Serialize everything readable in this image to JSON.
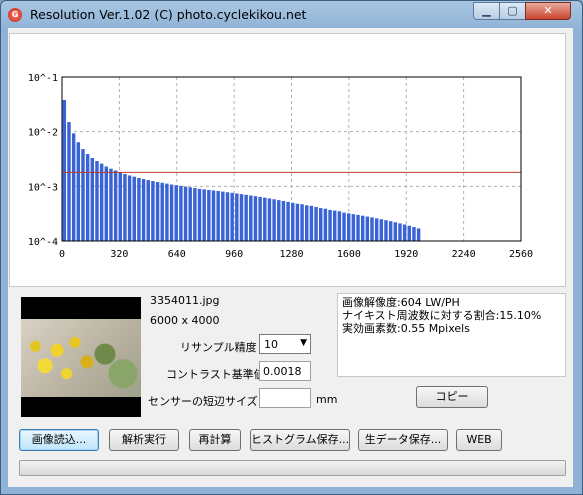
{
  "window": {
    "title": "Resolution Ver.1.02 (C) photo.cyclekikou.net",
    "app_icon": "red-circle-app-icon",
    "controls": {
      "minimize": "minimize-icon",
      "maximize": "maximize-icon",
      "close": "close-icon"
    }
  },
  "chart_data": {
    "type": "bar",
    "yscale": "log",
    "ylim": [
      "10^-4",
      "10^-1"
    ],
    "y_ticks": [
      "10^-1",
      "10^-2",
      "10^-3",
      "10^-4"
    ],
    "x_ticks": [
      "0",
      "320",
      "640",
      "960",
      "1280",
      "1600",
      "1920",
      "2240",
      "2560"
    ],
    "xlim": [
      0,
      2560
    ],
    "grid": true,
    "bar_color": "#3a63d6",
    "threshold_color": "#c0392b",
    "threshold": 0.0018,
    "bar_width": 26,
    "x": [
      13,
      39,
      65,
      91,
      117,
      143,
      169,
      195,
      221,
      247,
      273,
      299,
      325,
      351,
      377,
      403,
      429,
      455,
      481,
      507,
      533,
      559,
      585,
      611,
      637,
      663,
      689,
      715,
      741,
      767,
      793,
      819,
      845,
      871,
      897,
      923,
      949,
      975,
      1001,
      1027,
      1053,
      1079,
      1105,
      1131,
      1157,
      1183,
      1209,
      1235,
      1261,
      1287,
      1313,
      1339,
      1365,
      1391,
      1417,
      1443,
      1469,
      1495,
      1521,
      1547,
      1573,
      1599,
      1625,
      1651,
      1677,
      1703,
      1729,
      1755,
      1781,
      1807,
      1833,
      1859,
      1885,
      1911,
      1937,
      1963,
      1989
    ],
    "values": [
      0.038,
      0.015,
      0.0093,
      0.0064,
      0.0048,
      0.0039,
      0.0033,
      0.0029,
      0.0026,
      0.0023,
      0.0021,
      0.00195,
      0.0018,
      0.00168,
      0.00158,
      0.0015,
      0.00142,
      0.00136,
      0.0013,
      0.00125,
      0.0012,
      0.00116,
      0.00112,
      0.00108,
      0.00105,
      0.00102,
      0.00099,
      0.00096,
      0.00093,
      0.0009,
      0.00088,
      0.00086,
      0.00084,
      0.00082,
      0.0008,
      0.00078,
      0.00076,
      0.00074,
      0.00072,
      0.0007,
      0.00068,
      0.00066,
      0.00064,
      0.00062,
      0.0006,
      0.00058,
      0.00056,
      0.00054,
      0.00052,
      0.0005,
      0.00048,
      0.00047,
      0.00045,
      0.00044,
      0.00042,
      0.0004,
      0.00039,
      0.00037,
      0.00036,
      0.00035,
      0.00033,
      0.00032,
      0.00031,
      0.0003,
      0.00029,
      0.00028,
      0.00027,
      0.00026,
      0.00025,
      0.00024,
      0.00023,
      0.00022,
      0.00021,
      0.0002,
      0.00019,
      0.00018,
      0.00017
    ]
  },
  "image": {
    "filename": "3354011.jpg",
    "dimensions": "6000 x 4000"
  },
  "settings": {
    "resample_label": "リサンプル精度",
    "resample_value": "10",
    "contrast_label": "コントラスト基準値",
    "contrast_value": "0.0018",
    "sensor_label": "センサーの短辺サイズ",
    "sensor_value": "",
    "sensor_unit": "mm"
  },
  "results": {
    "line1": "画像解像度:604 LW/PH",
    "line2": "ナイキスト周波数に対する割合:15.10%",
    "line3": "実効画素数:0.55 Mpixels"
  },
  "buttons": {
    "copy": "コピー",
    "load": "画像読込...",
    "analyze": "解析実行",
    "recalc": "再計算",
    "save_histogram": "ヒストグラム保存...",
    "save_raw": "生データ保存...",
    "web": "WEB"
  },
  "progress": {
    "value": 0
  }
}
